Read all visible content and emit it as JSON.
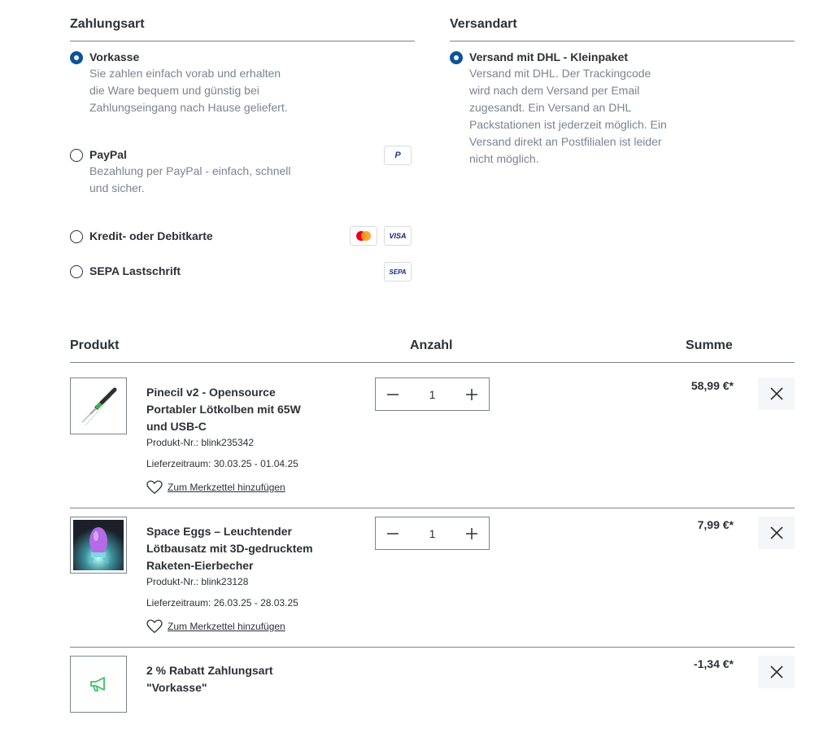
{
  "payment": {
    "title": "Zahlungsart",
    "options": [
      {
        "title": "Vorkasse",
        "desc": [
          "Sie zahlen einfach vorab und erhalten",
          "die Ware bequem und günstig bei",
          "Zahlungseingang nach Hause geliefert."
        ],
        "selected": true
      },
      {
        "title": "PayPal",
        "desc": [
          "Bezahlung per PayPal - einfach, schnell",
          "und sicher."
        ],
        "selected": false
      },
      {
        "title": "Kredit- oder Debitkarte",
        "desc": [],
        "selected": false
      },
      {
        "title": "SEPA Lastschrift",
        "desc": [],
        "selected": false
      }
    ],
    "logos": {
      "paypal": "P",
      "visa": "VISA",
      "sepa": "SEPA"
    }
  },
  "shipping": {
    "title": "Versandart",
    "options": [
      {
        "title": "Versand mit DHL - Kleinpaket",
        "desc": [
          "Versand mit DHL. Der Trackingcode",
          "wird nach dem Versand per Email",
          "zugesandt. Ein Versand an DHL",
          "Packstationen ist jederzeit möglich. Ein",
          "Versand direkt an Postfilialen ist leider",
          "nicht möglich."
        ],
        "selected": true
      }
    ]
  },
  "cart": {
    "headers": {
      "product": "Produkt",
      "quantity": "Anzahl",
      "sum": "Summe"
    },
    "items": [
      {
        "name": [
          "Pinecil v2 - Opensource",
          "Portabler Lötkolben mit 65W",
          "und USB-C"
        ],
        "product_no": "Produkt-Nr.: blink235342",
        "delivery": "Lieferzeitraum: 30.03.25 - 01.04.25",
        "wishlist": "Zum Merkzettel hinzufügen",
        "quantity": "1",
        "price": "58,99 €*"
      },
      {
        "name": [
          "Space Eggs – Leuchtender",
          "Lötbausatz mit 3D-gedrucktem",
          "Raketen-Eierbecher"
        ],
        "product_no": "Produkt-Nr.: blink23128",
        "delivery": "Lieferzeitraum: 26.03.25 - 28.03.25",
        "wishlist": "Zum Merkzettel hinzufügen",
        "quantity": "1",
        "price": "7,99 €*"
      },
      {
        "name": [
          "2 % Rabatt Zahlungsart",
          "\"Vorkasse\""
        ],
        "price": "-1,34 €*"
      }
    ]
  },
  "colors": {
    "accent": "#0b539b",
    "text": "#2b3136",
    "muted": "#798490",
    "discount_icon": "#3cc261"
  },
  "icons": {
    "remove": "close-icon",
    "wishlist": "heart-icon",
    "decrease": "minus-icon",
    "increase": "plus-icon",
    "discount": "megaphone-icon"
  }
}
